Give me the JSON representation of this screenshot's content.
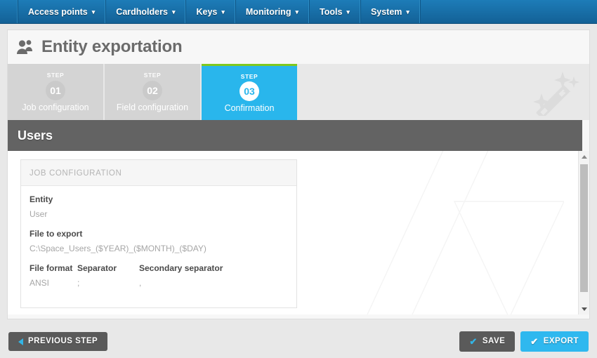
{
  "navbar": {
    "items": [
      {
        "label": "Access points",
        "caret": "chevron-down-icon"
      },
      {
        "label": "Cardholders",
        "caret": "chevron-down-icon"
      },
      {
        "label": "Keys",
        "caret": "chevron-down-icon"
      },
      {
        "label": "Monitoring",
        "caret": "chevron-down-icon"
      },
      {
        "label": "Tools",
        "caret": "chevron-down-icon"
      },
      {
        "label": "System",
        "caret": "chevron-down-icon"
      }
    ],
    "caret_glyph": "▾"
  },
  "page": {
    "title": "Entity exportation",
    "title_icon": "users-icon"
  },
  "wizard": {
    "kicker": "STEP",
    "decoration_icon": "magic-wand-icon",
    "steps": [
      {
        "number": "01",
        "label": "Job configuration",
        "active": false
      },
      {
        "number": "02",
        "label": "Field configuration",
        "active": false
      },
      {
        "number": "03",
        "label": "Confirmation",
        "active": true
      }
    ]
  },
  "subheader": {
    "title": "Users"
  },
  "card": {
    "header": "JOB CONFIGURATION",
    "fields": [
      {
        "label": "Entity",
        "value": "User"
      },
      {
        "label": "File to export",
        "value": "C:\\Space_Users_($YEAR)_($MONTH)_($DAY)"
      }
    ],
    "format_row": {
      "labels": [
        "File format",
        "Separator",
        "Secondary separator"
      ],
      "values": [
        "ANSI",
        ";",
        ","
      ]
    }
  },
  "scrollbar": {
    "up_icon": "scroll-up-arrow-icon",
    "down_icon": "scroll-down-arrow-icon"
  },
  "footer": {
    "previous": {
      "label": "PREVIOUS STEP",
      "icon": "chevron-left-icon"
    },
    "save": {
      "label": "SAVE",
      "icon": "check-icon"
    },
    "export": {
      "label": "EXPORT",
      "icon": "check-icon"
    },
    "check_glyph": "✔"
  },
  "colors": {
    "nav_blue_top": "#1d7cb8",
    "nav_blue_bottom": "#136196",
    "accent_blue": "#29b6ec",
    "accent_green": "#7fc81e",
    "subheader_gray": "#636363",
    "button_gray": "#5a5a5a",
    "export_blue": "#2fb8ef"
  }
}
